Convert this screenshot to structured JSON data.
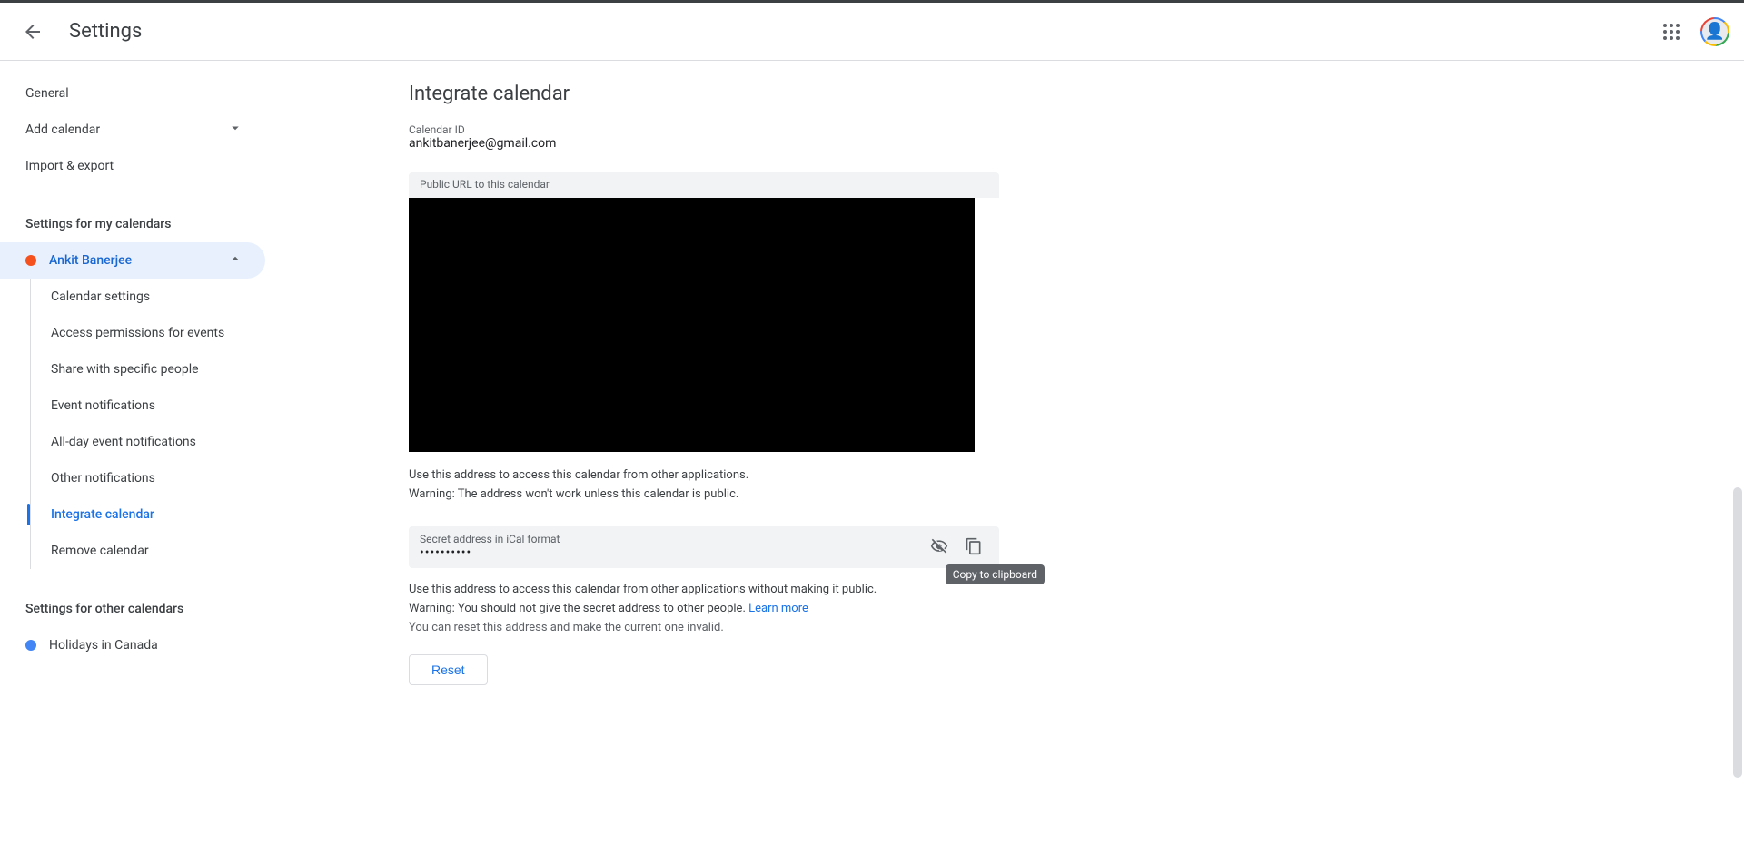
{
  "header": {
    "title": "Settings"
  },
  "sidebar": {
    "general": "General",
    "add_calendar": "Add calendar",
    "import_export": "Import & export",
    "my_calendars_header": "Settings for my calendars",
    "owner_name": "Ankit Banerjee",
    "sub": {
      "calendar_settings": "Calendar settings",
      "access_permissions": "Access permissions for events",
      "share_people": "Share with specific people",
      "event_notifications": "Event notifications",
      "allday_notifications": "All-day event notifications",
      "other_notifications": "Other notifications",
      "integrate_calendar": "Integrate calendar",
      "remove_calendar": "Remove calendar"
    },
    "other_calendars_header": "Settings for other calendars",
    "holidays": "Holidays in Canada"
  },
  "main": {
    "section_title": "Integrate calendar",
    "calendar_id_label": "Calendar ID",
    "calendar_id_value": "ankitbanerjee@gmail.com",
    "public_url_label": "Public URL to this calendar",
    "use_address_text": "Use this address to access this calendar from other applications.",
    "warning_public": "Warning: The address won't work unless this calendar is public.",
    "secret_label": "Secret address in iCal format",
    "secret_value": "••••••••••",
    "use_secret_text": "Use this address to access this calendar from other applications without making it public.",
    "warning_secret": "Warning: You should not give the secret address to other people. ",
    "learn_more": "Learn more",
    "reset_info": "You can reset this address and make the current one invalid.",
    "reset_button": "Reset",
    "tooltip_copy": "Copy to clipboard"
  }
}
